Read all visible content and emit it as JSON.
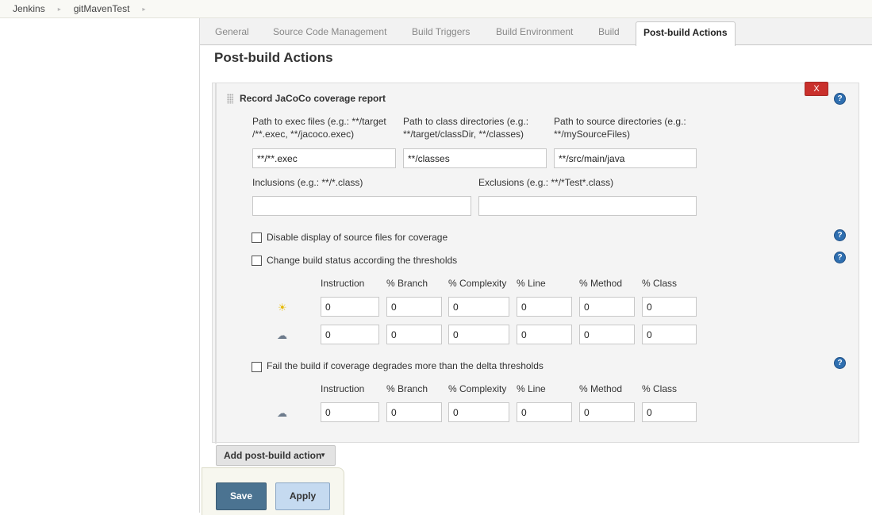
{
  "breadcrumb": {
    "items": [
      "Jenkins",
      "gitMavenTest"
    ],
    "separator": "▸"
  },
  "tabs": [
    "General",
    "Source Code Management",
    "Build Triggers",
    "Build Environment",
    "Build",
    "Post-build Actions"
  ],
  "active_tab": "Post-build Actions",
  "section_title": "Post-build Actions",
  "jacoco": {
    "title": "Record JaCoCo coverage report",
    "delete_label": "X",
    "help_glyph": "?",
    "exec_label_line1": "Path to exec files (e.g.: **/target",
    "exec_label_line2": "/**.exec, **/jacoco.exec)",
    "exec_value": "**/**.exec",
    "class_label_line1": "Path to class directories (e.g.:",
    "class_label_line2": "**/target/classDir, **/classes)",
    "class_value": "**/classes",
    "source_label_line1": "Path to source directories (e.g.:",
    "source_label_line2": "**/mySourceFiles)",
    "source_value": "**/src/main/java",
    "inclusions_label": "Inclusions (e.g.: **/*.class)",
    "inclusions_value": "",
    "exclusions_label": "Exclusions (e.g.: **/*Test*.class)",
    "exclusions_value": "",
    "disable_source_label": "Disable display of source files for coverage",
    "change_status_label": "Change build status according the thresholds",
    "fail_build_label": "Fail the build if coverage degrades more than the delta thresholds",
    "threshold_headers": [
      "Instruction",
      "% Branch",
      "% Complexity",
      "% Line",
      "% Method",
      "% Class"
    ],
    "healthy_icon": "sun-icon",
    "unhealthy_icon": "cloud-rain-icon",
    "healthy_values": [
      "0",
      "0",
      "0",
      "0",
      "0",
      "0"
    ],
    "unhealthy_values": [
      "0",
      "0",
      "0",
      "0",
      "0",
      "0"
    ],
    "delta_headers": [
      "Instruction",
      "% Branch",
      "% Complexity",
      "% Line",
      "% Method",
      "% Class"
    ],
    "delta_values": [
      "0",
      "0",
      "0",
      "0",
      "0",
      "0"
    ]
  },
  "add_action_label": "Add post-build action",
  "add_action_caret": "▼",
  "save_label": "Save",
  "apply_label": "Apply",
  "colors": {
    "delete": "#c9302c",
    "help": "#2f6fb0",
    "save": "#4b7391",
    "apply": "#c5daf0"
  }
}
